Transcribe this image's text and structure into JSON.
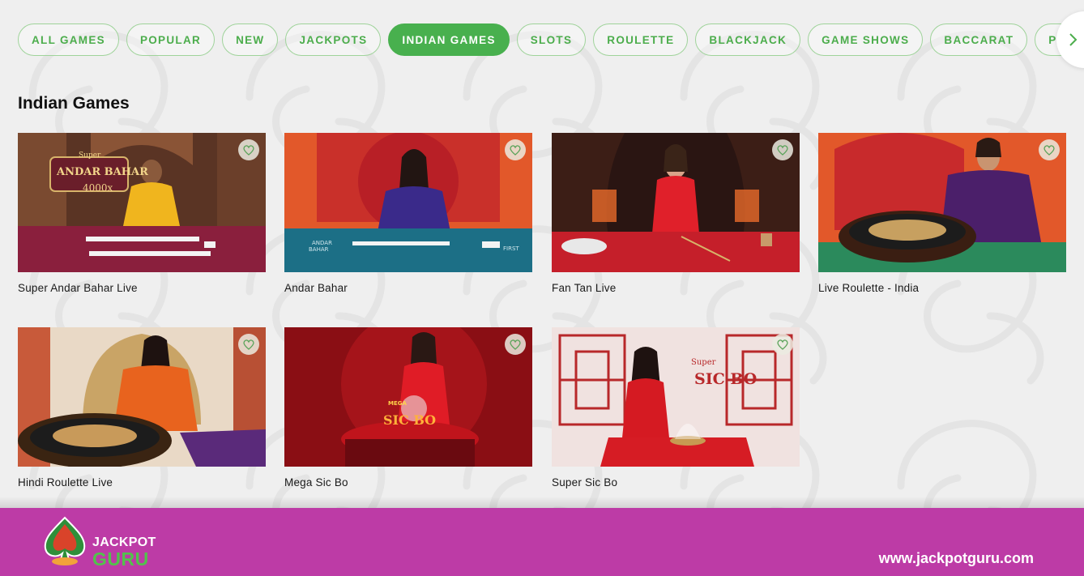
{
  "tabs": [
    {
      "label": "ALL GAMES",
      "active": false
    },
    {
      "label": "POPULAR",
      "active": false
    },
    {
      "label": "NEW",
      "active": false
    },
    {
      "label": "JACKPOTS",
      "active": false
    },
    {
      "label": "INDIAN GAMES",
      "active": true
    },
    {
      "label": "SLOTS",
      "active": false
    },
    {
      "label": "ROULETTE",
      "active": false
    },
    {
      "label": "BLACKJACK",
      "active": false
    },
    {
      "label": "GAME SHOWS",
      "active": false
    },
    {
      "label": "BACCARAT",
      "active": false
    },
    {
      "label": "POKER",
      "active": false
    }
  ],
  "next_icon": "chevron-right-icon",
  "section": {
    "title": "Indian Games"
  },
  "games": [
    {
      "name": "Super Andar Bahar Live",
      "thumb_text": [
        "Super",
        "ANDAR BAHAR",
        "4000x"
      ]
    },
    {
      "name": "Andar Bahar",
      "thumb_text": [
        "ANDAR",
        "BAHAR",
        "FIRST"
      ]
    },
    {
      "name": "Fan Tan Live",
      "thumb_text": []
    },
    {
      "name": "Live Roulette - India",
      "thumb_text": []
    },
    {
      "name": "Hindi Roulette Live",
      "thumb_text": []
    },
    {
      "name": "Mega Sic Bo",
      "thumb_text": [
        "MEGA",
        "SIC BO"
      ]
    },
    {
      "name": "Super Sic Bo",
      "thumb_text": [
        "Super",
        "SIC BO"
      ]
    }
  ],
  "favorite_icon": "heart-icon",
  "footer": {
    "logo_line1": "JACKPOT",
    "logo_line2": "GURU",
    "url": "www.jackpotguru.com"
  },
  "colors": {
    "accent_green": "#48b04e",
    "footer_magenta": "#bd3ba6",
    "background": "#efefef"
  }
}
